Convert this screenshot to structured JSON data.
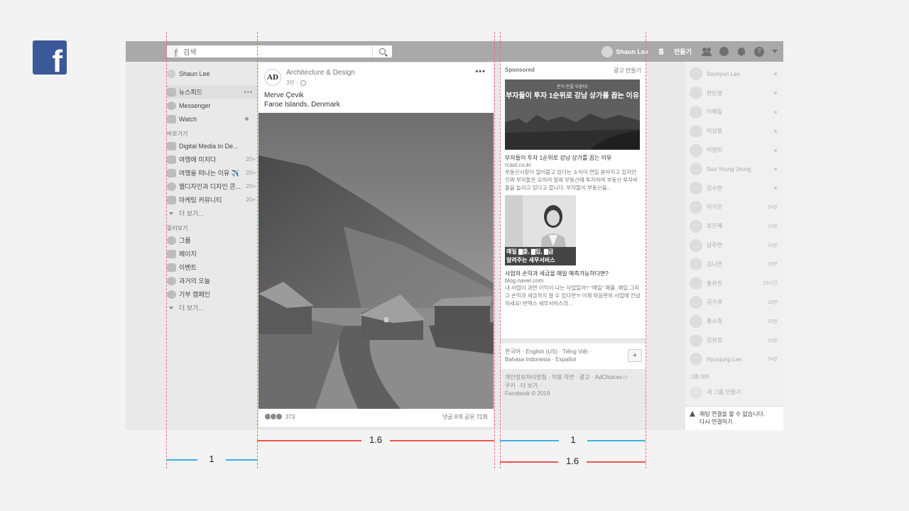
{
  "topbar": {
    "search_placeholder": "검색",
    "user_name": "Shaun Lee",
    "home": "홈",
    "create": "만들기"
  },
  "left_sidebar": {
    "user": "Shaun Lee",
    "main_items": [
      {
        "label": "뉴스피드",
        "icon": "newsfeed-icon"
      },
      {
        "label": "Messenger",
        "icon": "messenger-icon"
      },
      {
        "label": "Watch",
        "icon": "watch-icon"
      }
    ],
    "shortcuts_title": "바로가기",
    "shortcuts": [
      {
        "label": "Digital Media In De...",
        "count": ""
      },
      {
        "label": "여행에 미치다",
        "count": "20+"
      },
      {
        "label": "여행을 떠나는 이유 ✈️",
        "count": "20+"
      },
      {
        "label": "웹디자인과 디자인 콘...",
        "count": "20+"
      },
      {
        "label": "마케팅 커뮤니티",
        "count": "20+"
      }
    ],
    "see_more": "더 보기...",
    "explore_title": "둘러보기",
    "explore": [
      {
        "label": "그룹",
        "icon": "groups-icon"
      },
      {
        "label": "페이지",
        "icon": "pages-icon"
      },
      {
        "label": "이벤트",
        "icon": "events-icon"
      },
      {
        "label": "과거의 오늘",
        "icon": "memories-icon"
      },
      {
        "label": "기부 캠페인",
        "icon": "fundraiser-icon"
      }
    ],
    "see_more_2": "더 보기..."
  },
  "post": {
    "page_name": "Architecture & Design",
    "logo_text": "AD",
    "time": "3분 ·",
    "text_line1": "Merve Çevik",
    "text_line2": "Faroe Islands, Denmark",
    "reaction_count": "373",
    "stats": "댓글 8개  공유 72회"
  },
  "ads": {
    "sponsored": "Sponsored",
    "create_ad": "광고 만들기",
    "ad1": {
      "image_small": "돈이 돈을 부른다!",
      "image_big": "부자들이 투자 1순위로 강남 상가를 꼽는 이유",
      "title": "부자들이 투자 1순위로 강남 상가를 꼽는 이유",
      "url": "rcast.co.kr",
      "desc": "부동산시장이 얼어붙고 있다는 소식이 연일 쏟아지고 있지만 진짜 부자들은 오히려 알짜 부동산에 투자하며 부동산 투자비율을 늘리고 있다고 합니다. 부자들이 부동산을..."
    },
    "ad2": {
      "image_banner_1": "매일 ▇출, ▇입, ▇금",
      "image_banner_2": "알려주는 세무서비스",
      "title": "사업의 손익과 세금을 매일 예측가능하다면?",
      "url": "blog.naver.com",
      "desc": "내 사업이 과연 이익이 나는 사업일까? \"매일\" 매출, 매입 그리고 손익과 세금까지 알 수 있다면?! 이제 마음편히 사업에 전념하세요! 반텍스 세무서비스의..."
    },
    "languages_1": "한국어 · English (US) · Tiếng Việt ·",
    "languages_2": "Bahasa Indonesia · Español",
    "plus": "+",
    "footer_1": "개인정보처리방침 · 이용 약관 · 광고 · AdChoices ▷ ·",
    "footer_2": "쿠키 · 더 보기 ·",
    "footer_3": "Facebook © 2019"
  },
  "chat": {
    "contacts": [
      {
        "name": "Soohyun Lee",
        "status": ""
      },
      {
        "name": "한민경",
        "status": ""
      },
      {
        "name": "이해림",
        "status": ""
      },
      {
        "name": "이상용",
        "status": ""
      },
      {
        "name": "이정미",
        "status": ""
      },
      {
        "name": "Soo Young Jeong",
        "status": ""
      },
      {
        "name": "김수현",
        "status": ""
      },
      {
        "name": "이가은",
        "status": "54분"
      },
      {
        "name": "조은혜",
        "status": "24분"
      },
      {
        "name": "남주연",
        "status": "19분"
      },
      {
        "name": "김나연",
        "status": "39분"
      },
      {
        "name": "홍유진",
        "status": "10시간"
      },
      {
        "name": "김수경",
        "status": "18분"
      },
      {
        "name": "홍소희",
        "status": "35분"
      },
      {
        "name": "김유정",
        "status": "33분"
      },
      {
        "name": "Hyunjung Lee",
        "status": "54분"
      }
    ],
    "group_title": "그룹 대화",
    "new_group": "새 그룹 만들기",
    "warning_1": "채팅 연결을 할 수 없습니다.",
    "warning_2": "다시 연결하기"
  },
  "guides": {
    "label_left": "1",
    "label_center": "1.6",
    "label_right_top": "1",
    "label_right_bottom": "1.6"
  },
  "colors": {
    "brand": "#3b5998",
    "guide_red": "#ef5350",
    "guide_blue": "#3ab0e6"
  }
}
